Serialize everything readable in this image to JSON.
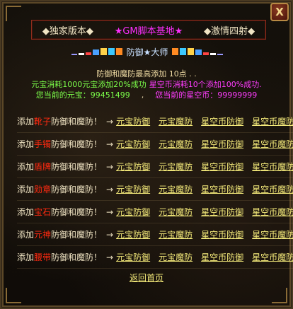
{
  "close_label": "X",
  "title_bar": {
    "left": "◆独家版本◆",
    "center": "★GM脚本基地★",
    "right": "◆激情四射◆"
  },
  "banner": {
    "text": "防御★大师",
    "left_swatch_colors": [
      "#9898ff",
      "#ffffff",
      "#ff4444",
      "#4aa0ff",
      "#ffd24a",
      "#3cc8ff",
      "#ff8a22"
    ],
    "right_swatch_colors": [
      "#ff8a22",
      "#3cc8ff",
      "#ffd24a",
      "#4aa0ff",
      "#ff4444",
      "#ffffff",
      "#9898ff"
    ]
  },
  "info": {
    "line1": "防御和魔防最高添加 10点 . .",
    "line2_a": "元宝消耗1000元宝添加20%成功",
    "line2_b": "星空币消耗10个添加100%成功.",
    "line3_a": "您当前的元宝：99451499",
    "line3_sep": ",",
    "line3_b": "您当前的星空币：99999999"
  },
  "rows": [
    {
      "prefix": "添加",
      "item": "靴子",
      "suffix": "防御和魔防！",
      "arrow": "→",
      "links": [
        "元宝防御",
        "元宝魔防",
        "星空币防御",
        "星空币魔防"
      ]
    },
    {
      "prefix": "添加",
      "item": "手镯",
      "suffix": "防御和魔防！",
      "arrow": "→",
      "links": [
        "元宝防御",
        "元宝魔防",
        "星空币防御",
        "星空币魔防"
      ]
    },
    {
      "prefix": "添加",
      "item": "盾牌",
      "suffix": "防御和魔防！",
      "arrow": "→",
      "links": [
        "元宝防御",
        "元宝魔防",
        "星空币防御",
        "星空币魔防"
      ]
    },
    {
      "prefix": "添加",
      "item": "勋章",
      "suffix": "防御和魔防！",
      "arrow": "→",
      "links": [
        "元宝防御",
        "元宝魔防",
        "星空币防御",
        "星空币魔防"
      ]
    },
    {
      "prefix": "添加",
      "item": "宝石",
      "suffix": "防御和魔防！",
      "arrow": "→",
      "links": [
        "元宝防御",
        "元宝魔防",
        "星空币防御",
        "星空币魔防"
      ]
    },
    {
      "prefix": "添加",
      "item": "元神",
      "suffix": "防御和魔防！",
      "arrow": "→",
      "links": [
        "元宝防御",
        "元宝魔防",
        "星空币防御",
        "星空币魔防"
      ]
    },
    {
      "prefix": "添加",
      "item": "腰带",
      "suffix": "防御和魔防！",
      "arrow": "→",
      "links": [
        "元宝防御",
        "元宝魔防",
        "星空币防御",
        "星空币魔防"
      ]
    }
  ],
  "back_label": "返回首页"
}
